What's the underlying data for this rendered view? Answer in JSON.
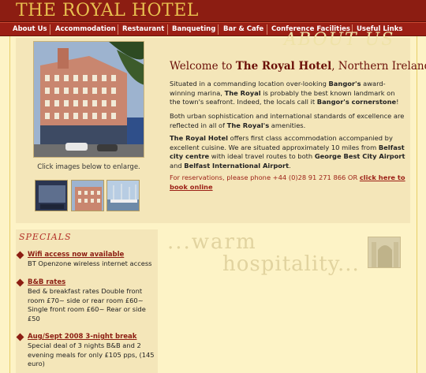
{
  "header": {
    "logo_text": "THE ROYAL HOTEL"
  },
  "nav": {
    "items": [
      "About Us",
      "Accommodation",
      "Restaurant",
      "Banqueting",
      "Bar & Cafe",
      "Conference Facilities",
      "Useful Links"
    ]
  },
  "section_watermark": "ABOUT US",
  "gallery": {
    "caption": "Click images below to enlarge.",
    "thumbs": [
      "thumb-interior",
      "thumb-exterior",
      "thumb-marina"
    ]
  },
  "welcome": {
    "prefix": "Welcome to ",
    "name": "The Royal Hotel",
    "suffix": ", Northern Ireland"
  },
  "paragraphs": {
    "p1": {
      "a": "Situated in a commanding location over-looking ",
      "b1": "Bangor's",
      "c": " award-winning marina, ",
      "b2": "The Royal",
      "d": " is probably the best known landmark on the town's seafront. Indeed, the locals call it ",
      "b3": "Bangor's cornerstone",
      "e": "!"
    },
    "p2": {
      "a": "Both urban sophistication and international standards of excellence are reflected in all of ",
      "b1": "The Royal's",
      "c": " amenities."
    },
    "p3": {
      "b1": "The Royal Hotel",
      "a": " offers first class accommodation accompanied by excellent cuisine. We are situated approximately 10 miles from ",
      "b2": "Belfast city centre",
      "c": " with ideal travel routes to both ",
      "b3": "George Best City Airport",
      "d": " and ",
      "b4": "Belfast International Airport",
      "e": "."
    }
  },
  "reservation": {
    "text": "For reservations, please phone +44 (0)28 91 271 866 OR ",
    "link": "click here to book online"
  },
  "specials": {
    "heading": "SPECIALS",
    "items": [
      {
        "title": "Wifi access now available",
        "desc": "BT Openzone wireless internet access"
      },
      {
        "title": "B&B rates",
        "desc": "Bed & breakfast rates Double front room £70~ side or rear room £60~ Single front room £60~ Rear or side £50"
      },
      {
        "title": "Aug/Sept 2008 3-night break",
        "desc": "Special deal of 3 nights B&B and 2 evening meals for only £105 pps, (145 euro)"
      }
    ]
  },
  "tagline": {
    "line1": "...warm",
    "line2": "hospitality..."
  },
  "colors": {
    "header_bg": "#8c1d12",
    "page_bg": "#fdf3c6",
    "accent": "#e8c04f"
  }
}
